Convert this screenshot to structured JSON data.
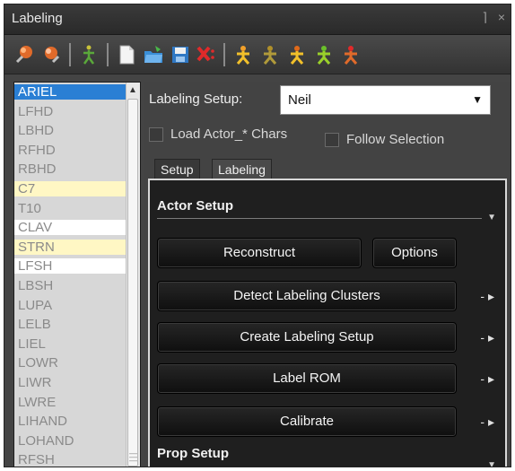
{
  "window": {
    "title": "Labeling",
    "pin_glyph": "⌉",
    "close_glyph": "×"
  },
  "toolbar": {
    "icons": [
      "marker-add-icon",
      "marker-remove-icon",
      "skeleton-icon",
      "new-document-icon",
      "open-folder-icon",
      "save-icon",
      "delete-icon",
      "actor-label-icon",
      "actor-unlabel-icon",
      "actor-assign-icon",
      "actor-solve-icon",
      "actor-clear-icon"
    ]
  },
  "marker_list": {
    "items": [
      {
        "label": "ARIEL",
        "state": "selected"
      },
      {
        "label": "LFHD",
        "state": "normal"
      },
      {
        "label": "LBHD",
        "state": "normal"
      },
      {
        "label": "RFHD",
        "state": "normal"
      },
      {
        "label": "RBHD",
        "state": "normal"
      },
      {
        "label": "C7",
        "state": "highlight"
      },
      {
        "label": "T10",
        "state": "normal"
      },
      {
        "label": "CLAV",
        "state": "white"
      },
      {
        "label": "STRN",
        "state": "highlight"
      },
      {
        "label": "LFSH",
        "state": "white"
      },
      {
        "label": "LBSH",
        "state": "normal"
      },
      {
        "label": "LUPA",
        "state": "normal"
      },
      {
        "label": "LELB",
        "state": "normal"
      },
      {
        "label": "LIEL",
        "state": "normal"
      },
      {
        "label": "LOWR",
        "state": "normal"
      },
      {
        "label": "LIWR",
        "state": "normal"
      },
      {
        "label": "LWRE",
        "state": "normal"
      },
      {
        "label": "LIHAND",
        "state": "normal"
      },
      {
        "label": "LOHAND",
        "state": "normal"
      },
      {
        "label": "RFSH",
        "state": "normal"
      }
    ]
  },
  "labeling_setup": {
    "label": "Labeling Setup:",
    "value": "Neil"
  },
  "options": {
    "load_actor": "Load Actor_* Chars",
    "follow_selection": "Follow Selection"
  },
  "tabs": [
    "Setup",
    "Labeling"
  ],
  "actor_setup": {
    "title": "Actor Setup",
    "buttons": {
      "reconstruct": "Reconstruct",
      "options": "Options",
      "detect_clusters": "Detect Labeling Clusters",
      "create_setup": "Create Labeling Setup",
      "label_rom": "Label ROM",
      "calibrate": "Calibrate"
    },
    "more_glyph": "- ▸"
  },
  "prop_setup": {
    "title": "Prop Setup"
  }
}
